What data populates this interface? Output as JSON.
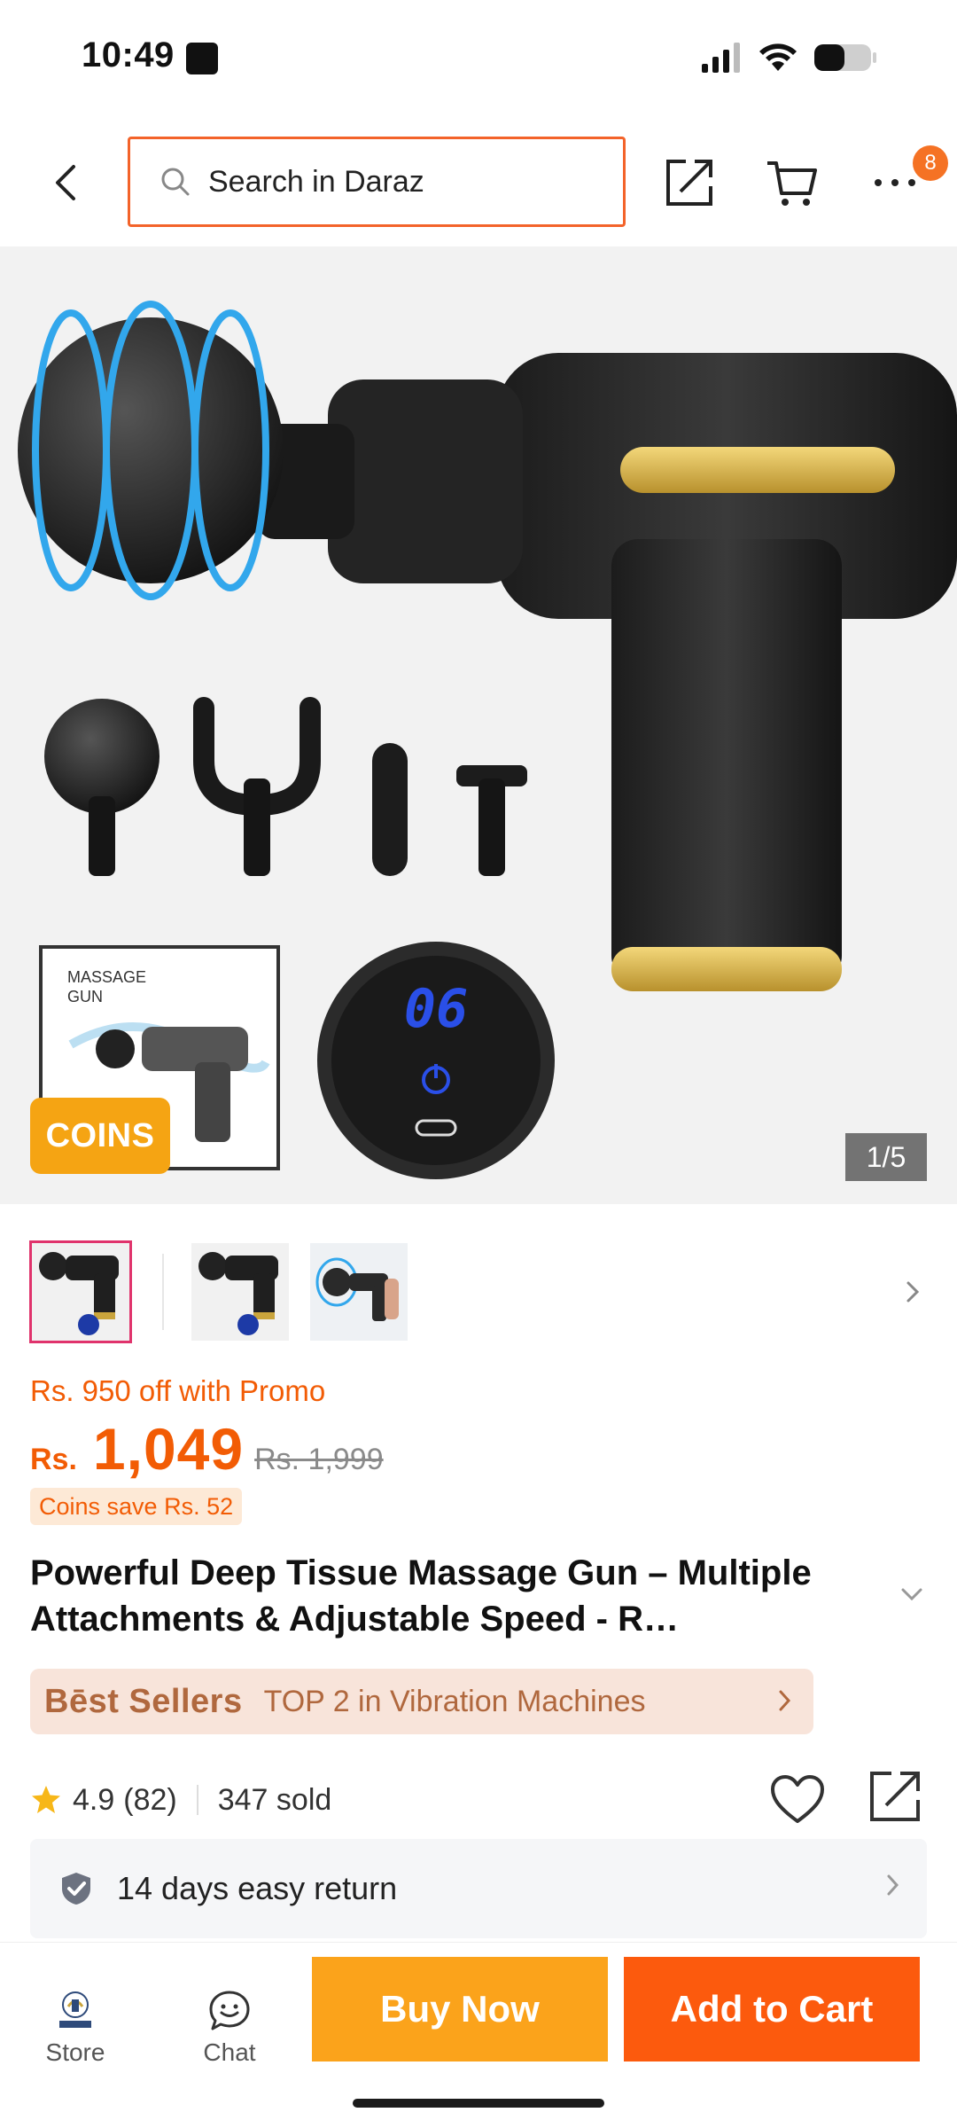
{
  "status_bar": {
    "time": "10:49"
  },
  "search": {
    "placeholder": "Search in Daraz"
  },
  "header": {
    "cart_badge": "8"
  },
  "gallery": {
    "coins_badge": "COINS",
    "counter": "1/5",
    "box_caption_line1": "MASSAGE",
    "box_caption_line2": "GUN",
    "display_digits": "06"
  },
  "pricing": {
    "promo": "Rs. 950 off with Promo",
    "currency": "Rs.",
    "price": "1,049",
    "original_price": "Rs. 1,999",
    "coins_save": "Coins save Rs. 52"
  },
  "product": {
    "title": "Powerful Deep Tissue Massage Gun – Multiple Attachments & Adjustable Speed - R…"
  },
  "best_sellers": {
    "brand": "Bēst Sellers",
    "text": "TOP 2 in Vibration Machines"
  },
  "rating": {
    "value": "4.9",
    "count": "(82)",
    "sold": "347 sold"
  },
  "returns": {
    "text": "14 days easy return"
  },
  "bottom_bar": {
    "store_label": "Store",
    "chat_label": "Chat",
    "buy_now": "Buy Now",
    "add_to_cart": "Add to Cart"
  },
  "colors": {
    "accent_orange": "#f25c05",
    "buy_now_bg": "#fba31b",
    "add_to_cart_bg": "#fc5a0d",
    "search_border": "#f3632a"
  }
}
